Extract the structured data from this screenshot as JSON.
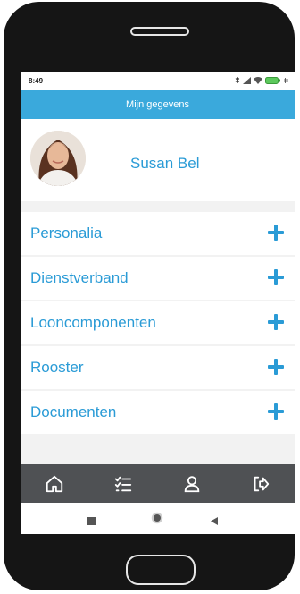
{
  "status_bar": {
    "time": "8:49"
  },
  "app_bar": {
    "title": "Mijn gegevens"
  },
  "profile": {
    "name": "Susan Bel"
  },
  "menu": {
    "items": [
      {
        "label": "Personalia",
        "icon": "plus-icon"
      },
      {
        "label": "Dienstverband",
        "icon": "plus-icon"
      },
      {
        "label": "Looncomponenten",
        "icon": "plus-icon"
      },
      {
        "label": "Rooster",
        "icon": "plus-icon"
      },
      {
        "label": "Documenten",
        "icon": "plus-icon"
      }
    ]
  },
  "bottom_nav": {
    "items": [
      "home-icon",
      "checklist-icon",
      "user-icon",
      "logout-icon"
    ]
  },
  "system_nav": {
    "items": [
      "recents-icon",
      "home-icon",
      "back-icon"
    ]
  },
  "colors": {
    "accent": "#3aa9dc",
    "text_accent": "#2a9bd6",
    "nav_background": "#4f5154"
  }
}
